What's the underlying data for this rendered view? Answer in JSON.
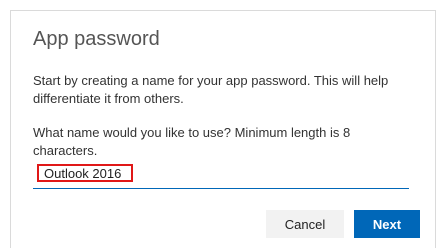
{
  "dialog": {
    "title": "App password",
    "description": "Start by creating a name for your app password. This will help differentiate it from others.",
    "question": "What name would you like to use? Minimum length is 8 characters.",
    "name_value": "Outlook 2016",
    "cancel_label": "Cancel",
    "next_label": "Next"
  },
  "colors": {
    "accent": "#0067b8",
    "highlight_border": "#e01818",
    "cancel_bg": "#f2f2f2"
  }
}
